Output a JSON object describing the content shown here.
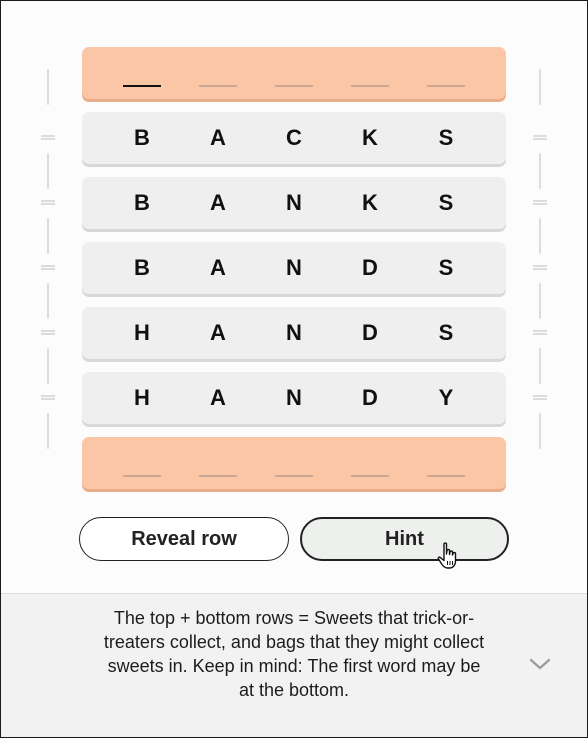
{
  "board": {
    "top_row": {
      "letters": [
        "",
        "",
        "",
        "",
        ""
      ],
      "active_index": 0
    },
    "rows": [
      {
        "letters": [
          "B",
          "A",
          "C",
          "K",
          "S"
        ]
      },
      {
        "letters": [
          "B",
          "A",
          "N",
          "K",
          "S"
        ]
      },
      {
        "letters": [
          "B",
          "A",
          "N",
          "D",
          "S"
        ]
      },
      {
        "letters": [
          "H",
          "A",
          "N",
          "D",
          "S"
        ]
      },
      {
        "letters": [
          "H",
          "A",
          "N",
          "D",
          "Y"
        ]
      }
    ],
    "bottom_row": {
      "letters": [
        "",
        "",
        "",
        "",
        ""
      ]
    }
  },
  "buttons": {
    "reveal_row": "Reveal row",
    "hint": "Hint"
  },
  "hint_panel": {
    "text": "The top + bottom rows = Sweets that trick-or-treaters collect, and bags that they might collect sweets in. Keep in mind: The first word may be at the bottom.",
    "toggle_icon": "chevron-down-icon"
  },
  "colors": {
    "answer_row": "#fbc6a6",
    "ladder_row": "#efefef",
    "text": "#111111"
  }
}
